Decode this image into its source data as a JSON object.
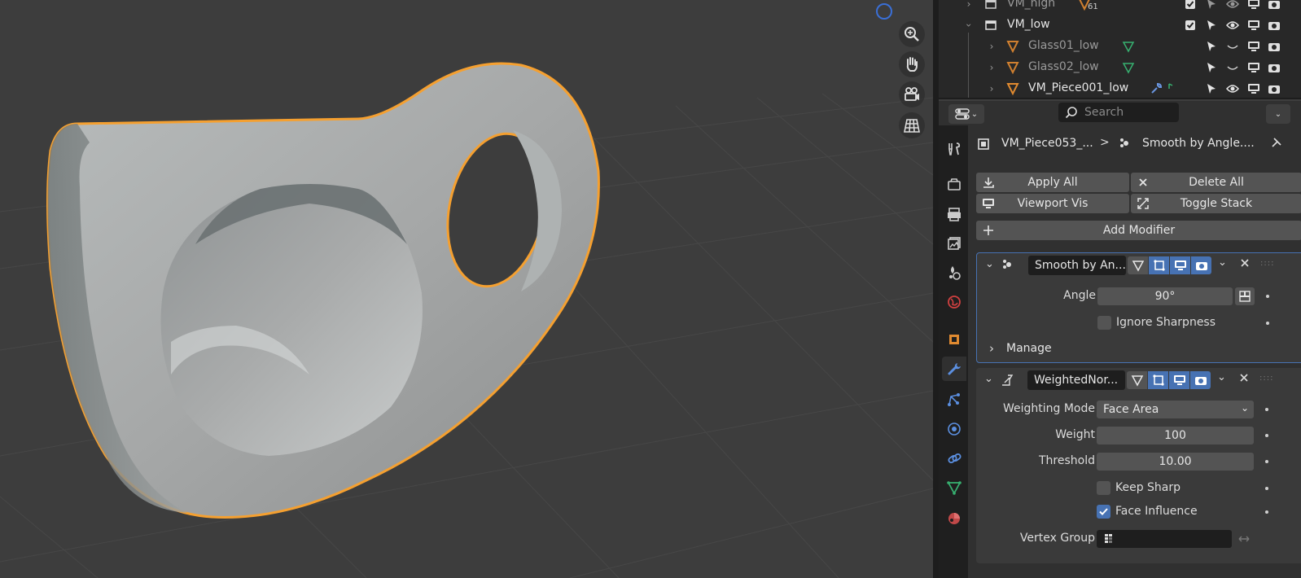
{
  "viewport": {
    "nav_icons": [
      "zoom-icon",
      "pan-hand-icon",
      "camera-icon",
      "grid-ortho-icon"
    ],
    "selection_outline_color": "#f5a030",
    "background_color": "#3d3d3d"
  },
  "outliner": {
    "rows": [
      {
        "label": "VM_high",
        "badge": "61"
      },
      {
        "label": "VM_low"
      },
      {
        "label": "Glass01_low"
      },
      {
        "label": "Glass02_low"
      },
      {
        "label": "VM_Piece001_low"
      }
    ]
  },
  "properties": {
    "search_placeholder": "Search",
    "breadcrumb": {
      "object": "VM_Piece053_...",
      "separator": ">",
      "modifier": "Smooth by Angle...."
    },
    "buttons": {
      "apply_all": "Apply All",
      "delete_all": "Delete All",
      "viewport_vis": "Viewport Vis",
      "toggle_stack": "Toggle Stack",
      "add_modifier": "Add Modifier"
    },
    "modifier1": {
      "name": "Smooth by An...",
      "angle_label": "Angle",
      "angle_value": "90°",
      "ignore_sharpness_label": "Ignore Sharpness",
      "ignore_sharpness_checked": false,
      "manage_label": "Manage"
    },
    "modifier2": {
      "name": "WeightedNor...",
      "weighting_mode_label": "Weighting Mode",
      "weighting_mode_value": "Face Area",
      "weight_label": "Weight",
      "weight_value": "100",
      "threshold_label": "Threshold",
      "threshold_value": "10.00",
      "keep_sharp_label": "Keep Sharp",
      "keep_sharp_checked": false,
      "face_influence_label": "Face Influence",
      "face_influence_checked": true,
      "vertex_group_label": "Vertex Group",
      "vertex_group_value": ""
    },
    "accent_color": "#4772b3"
  }
}
